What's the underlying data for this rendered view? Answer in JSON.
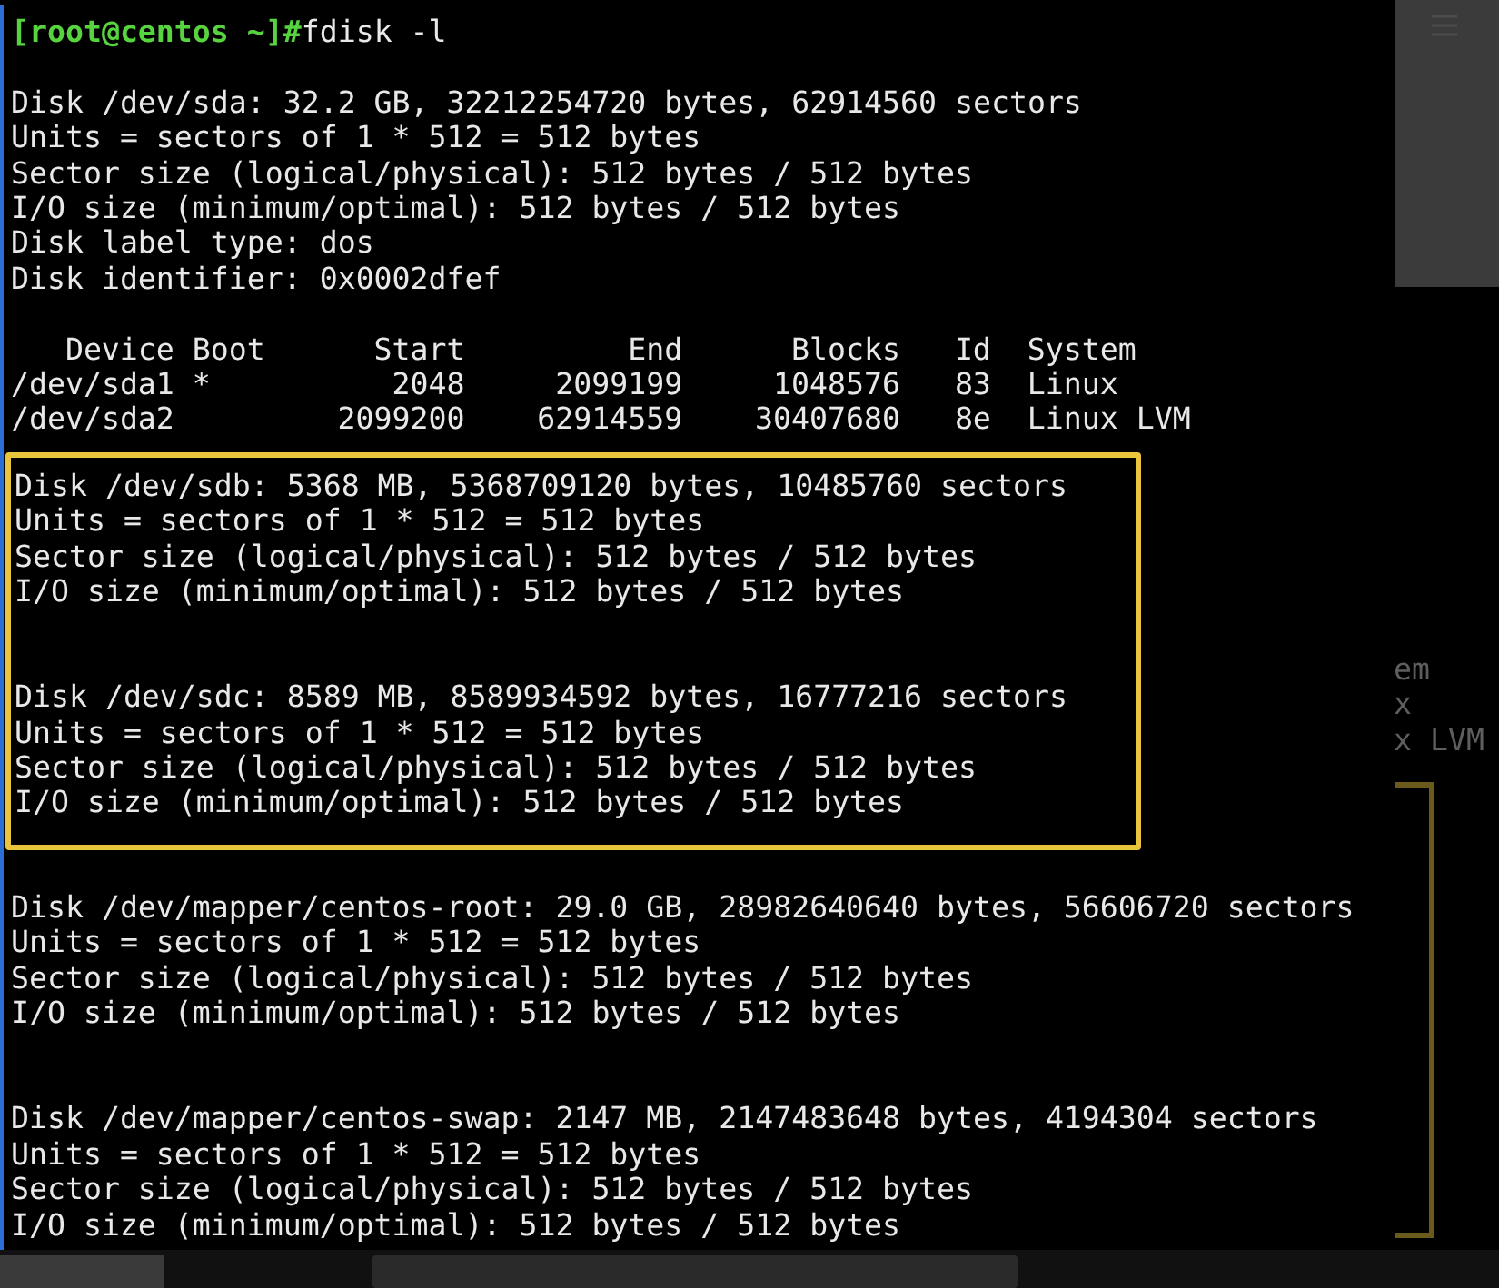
{
  "terminal": {
    "prompt": "[root@centos ~]#",
    "command": "fdisk -l",
    "blocks": [
      {
        "kind": "disk",
        "lines": [
          "Disk /dev/sda: 32.2 GB, 32212254720 bytes, 62914560 sectors",
          "Units = sectors of 1 * 512 = 512 bytes",
          "Sector size (logical/physical): 512 bytes / 512 bytes",
          "I/O size (minimum/optimal): 512 bytes / 512 bytes",
          "Disk label type: dos",
          "Disk identifier: 0x0002dfef"
        ]
      },
      {
        "kind": "partition_table",
        "columns": [
          "Device",
          "Boot",
          "Start",
          "End",
          "Blocks",
          "Id",
          "System"
        ],
        "rows": [
          [
            "/dev/sda1",
            "*",
            "2048",
            "2099199",
            "1048576",
            "83",
            "Linux"
          ],
          [
            "/dev/sda2",
            "",
            "2099200",
            "62914559",
            "30407680",
            "8e",
            "Linux LVM"
          ]
        ]
      },
      {
        "kind": "highlight_group",
        "disks": [
          {
            "lines": [
              "Disk /dev/sdb: 5368 MB, 5368709120 bytes, 10485760 sectors",
              "Units = sectors of 1 * 512 = 512 bytes",
              "Sector size (logical/physical): 512 bytes / 512 bytes",
              "I/O size (minimum/optimal): 512 bytes / 512 bytes"
            ]
          },
          {
            "lines": [
              "Disk /dev/sdc: 8589 MB, 8589934592 bytes, 16777216 sectors",
              "Units = sectors of 1 * 512 = 512 bytes",
              "Sector size (logical/physical): 512 bytes / 512 bytes",
              "I/O size (minimum/optimal): 512 bytes / 512 bytes"
            ]
          }
        ]
      },
      {
        "kind": "disk",
        "lines": [
          "Disk /dev/mapper/centos-root: 29.0 GB, 28982640640 bytes, 56606720 sectors",
          "Units = sectors of 1 * 512 = 512 bytes",
          "Sector size (logical/physical): 512 bytes / 512 bytes",
          "I/O size (minimum/optimal): 512 bytes / 512 bytes"
        ]
      },
      {
        "kind": "disk",
        "lines": [
          "Disk /dev/mapper/centos-swap: 2147 MB, 2147483648 bytes, 4194304 sectors",
          "Units = sectors of 1 * 512 = 512 bytes",
          "Sector size (logical/physical): 512 bytes / 512 bytes",
          "I/O size (minimum/optimal): 512 bytes / 512 bytes"
        ]
      }
    ]
  },
  "background_window": {
    "lines": [
      "em",
      "x",
      "x LVM"
    ]
  }
}
